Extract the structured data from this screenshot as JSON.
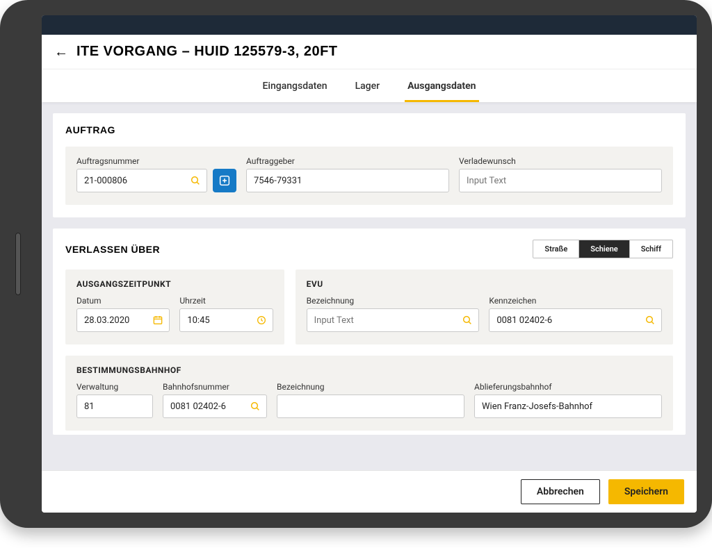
{
  "header": {
    "title": "ITE Vorgang – HUID 125579-3, 20ft"
  },
  "tabs": [
    {
      "label": "Eingangsdaten",
      "active": false
    },
    {
      "label": "Lager",
      "active": false
    },
    {
      "label": "Ausgangsdaten",
      "active": true
    }
  ],
  "auftrag": {
    "title": "Auftrag",
    "auftragsnummer_label": "Auftragsnummer",
    "auftragsnummer_value": "21-000806",
    "auftraggeber_label": "Auftraggeber",
    "auftraggeber_value": "7546-79331",
    "verladewunsch_label": "Verladewunsch",
    "verladewunsch_placeholder": "Input Text"
  },
  "verlassen": {
    "title": "Verlassen über",
    "segments": [
      {
        "label": "Straße",
        "active": false
      },
      {
        "label": "Schiene",
        "active": true
      },
      {
        "label": "Schiff",
        "active": false
      }
    ],
    "ausgang": {
      "panel_title": "AUSGANGSZEITPUNKT",
      "datum_label": "Datum",
      "datum_value": "28.03.2020",
      "uhrzeit_label": "Uhrzeit",
      "uhrzeit_value": "10:45"
    },
    "evu": {
      "panel_title": "EVU",
      "bezeichnung_label": "Bezeichnung",
      "bezeichnung_placeholder": "Input Text",
      "kennzeichen_label": "Kennzeichen",
      "kennzeichen_value": "0081 02402-6"
    },
    "bahnhof": {
      "panel_title": "BESTIMMUNGSBAHNHOF",
      "verwaltung_label": "Verwaltung",
      "verwaltung_value": "81",
      "bahnhofsnummer_label": "Bahnhofsnummer",
      "bahnhofsnummer_value": "0081 02402-6",
      "bezeichnung_label": "Bezeichnung",
      "bezeichnung_value": "",
      "ablieferung_label": "Ablieferungsbahnhof",
      "ablieferung_value": "Wien Franz-Josefs-Bahnhof"
    }
  },
  "footer": {
    "cancel_label": "Abbrechen",
    "save_label": "Speichern"
  },
  "colors": {
    "accent": "#f5b800",
    "primary_blue": "#167ac6"
  }
}
